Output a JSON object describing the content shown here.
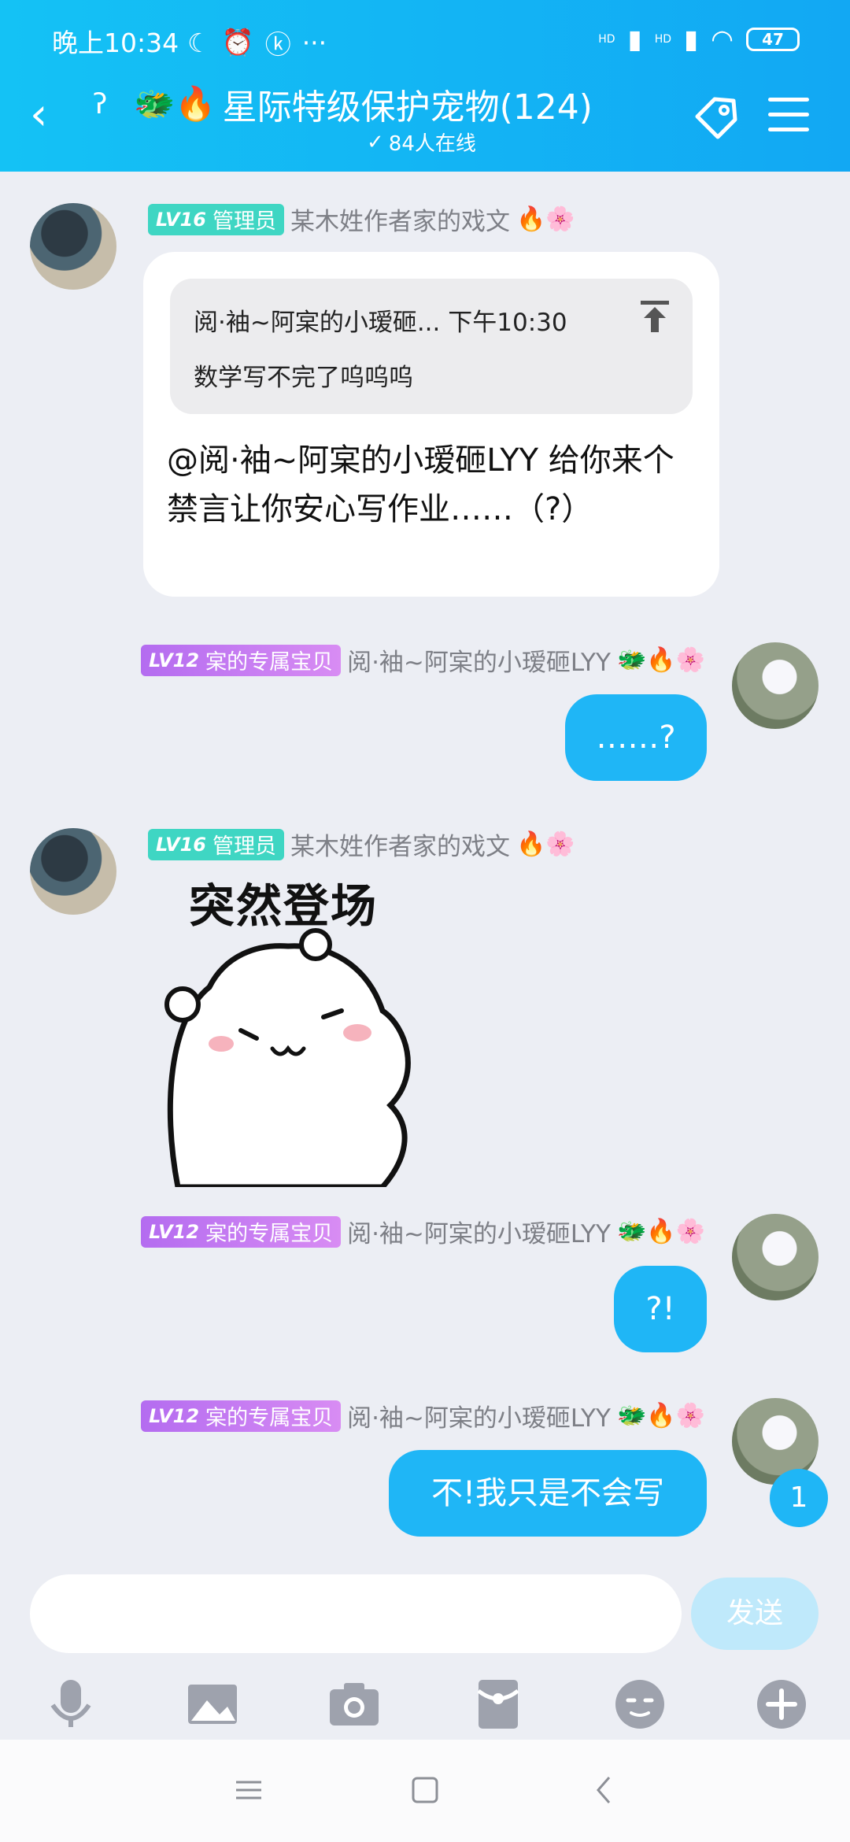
{
  "status_bar": {
    "time": "晚上10:34",
    "battery": "47",
    "more": "···",
    "hd1": "HD",
    "hd2": "HD"
  },
  "header": {
    "title": "星际特级保护宠物(124)",
    "online": "84人在线",
    "title_emojis": "🐲🔥"
  },
  "messages": [
    {
      "side": "left",
      "badge_level": "LV16",
      "badge_text": "管理员",
      "name": "某木姓作者家的戏文",
      "name_emojis": "🔥🌸",
      "quote": {
        "sender": "阅·袖~阿宲的小瑷砸...",
        "time": "下午10:30",
        "text": "数学写不完了呜呜呜"
      },
      "text": "@阅·袖~阿宲的小瑷砸LYY 给你来个禁言让你安心写作业……（?）"
    },
    {
      "side": "right",
      "badge_level": "LV12",
      "badge_text": "宲的专属宝贝",
      "name": "阅·袖~阿宲的小瑷砸LYY",
      "name_emojis": "🐲🔥🌸",
      "text": "……?"
    },
    {
      "side": "left",
      "badge_level": "LV16",
      "badge_text": "管理员",
      "name": "某木姓作者家的戏文",
      "name_emojis": "🔥🌸",
      "sticker_caption": "突然登场"
    },
    {
      "side": "right",
      "badge_level": "LV12",
      "badge_text": "宲的专属宝贝",
      "name": "阅·袖~阿宲的小瑷砸LYY",
      "name_emojis": "🐲🔥🌸",
      "text": "?!"
    },
    {
      "side": "right",
      "badge_level": "LV12",
      "badge_text": "宲的专属宝贝",
      "name": "阅·袖~阿宲的小瑷砸LYY",
      "name_emojis": "🐲🔥🌸",
      "text": "不!我只是不会写"
    }
  ],
  "unread_count": "1",
  "input": {
    "placeholder": "",
    "send_label": "发送"
  },
  "toolbar": [
    "microphone-icon",
    "image-icon",
    "camera-icon",
    "red-packet-icon",
    "emoji-icon",
    "plus-icon"
  ],
  "colors": {
    "header": "#14c2f5",
    "bubble_blue": "#1fb6f6",
    "admin_badge": "#3fd6c3",
    "baby_badge": "#b46cf0",
    "background": "#eceef4"
  }
}
